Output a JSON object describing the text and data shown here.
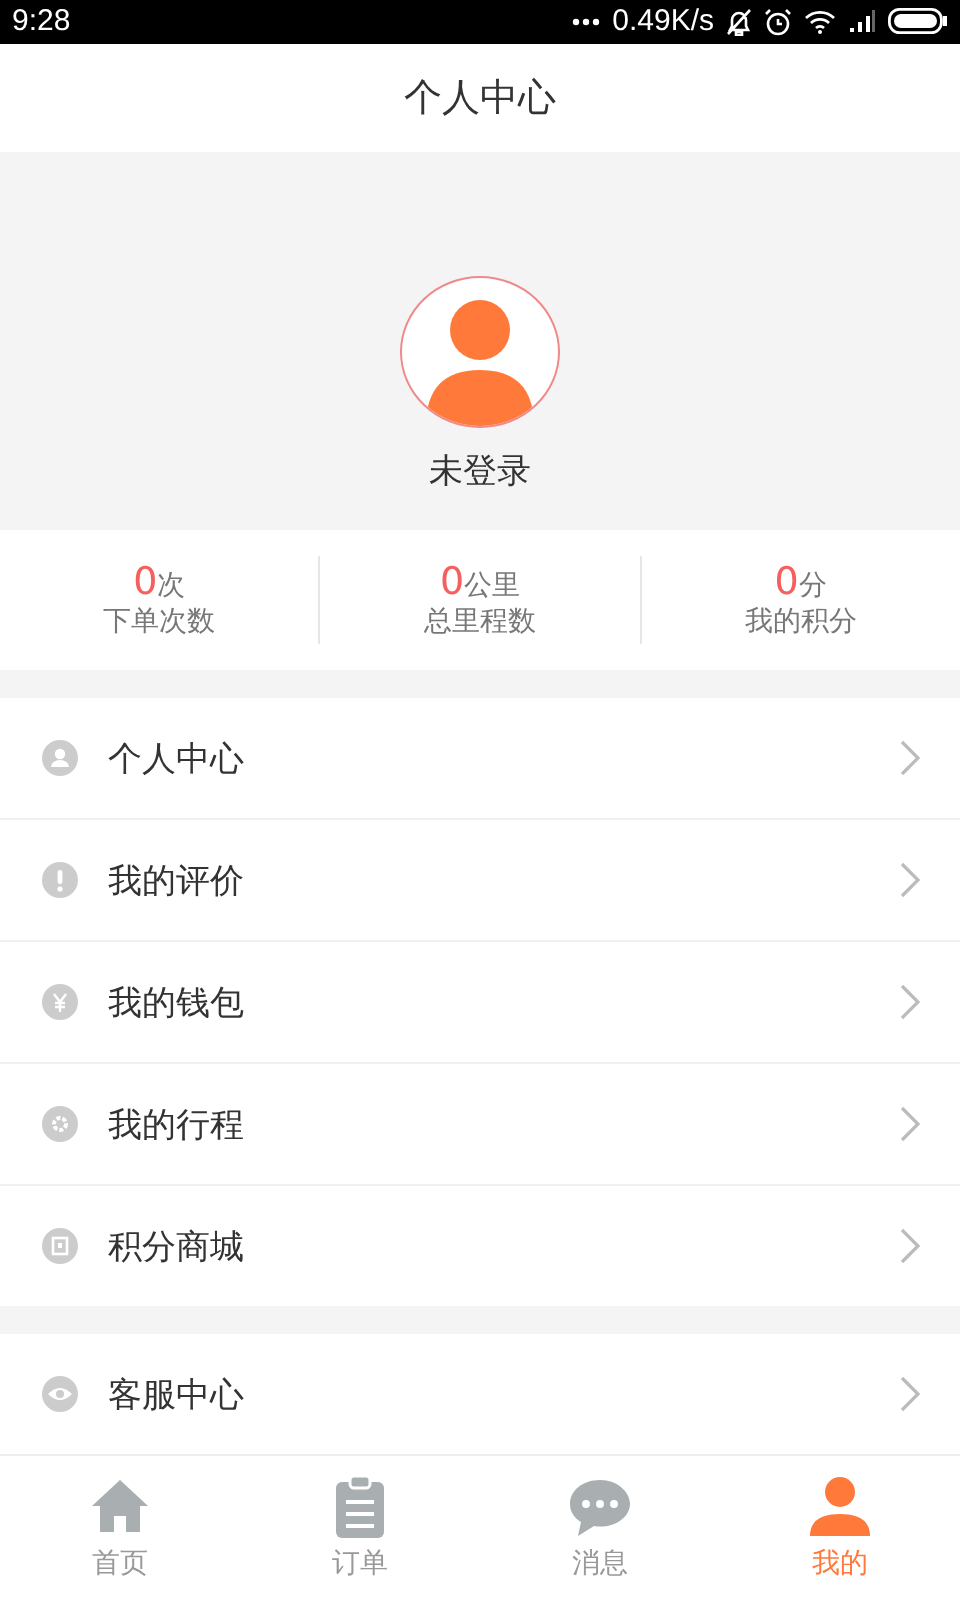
{
  "status_bar": {
    "time": "9:28",
    "speed": "0.49K/s"
  },
  "header": {
    "title": "个人中心"
  },
  "profile": {
    "name": "未登录"
  },
  "stats": [
    {
      "value": "0",
      "unit": "次",
      "label": "下单次数"
    },
    {
      "value": "0",
      "unit": "公里",
      "label": "总里程数"
    },
    {
      "value": "0",
      "unit": "分",
      "label": "我的积分"
    }
  ],
  "menu_groups": [
    [
      {
        "kind": "person",
        "label": "个人中心"
      },
      {
        "kind": "alert",
        "label": "我的评价"
      },
      {
        "kind": "yen",
        "label": "我的钱包"
      },
      {
        "kind": "gear",
        "label": "我的行程"
      },
      {
        "kind": "shop",
        "label": "积分商城"
      }
    ],
    [
      {
        "kind": "eye",
        "label": "客服中心"
      }
    ]
  ],
  "tab_bar": [
    {
      "kind": "home",
      "label": "首页",
      "selected": false
    },
    {
      "kind": "orders",
      "label": "订单",
      "selected": false
    },
    {
      "kind": "chat",
      "label": "消息",
      "selected": false
    },
    {
      "kind": "me",
      "label": "我的",
      "selected": true
    }
  ]
}
